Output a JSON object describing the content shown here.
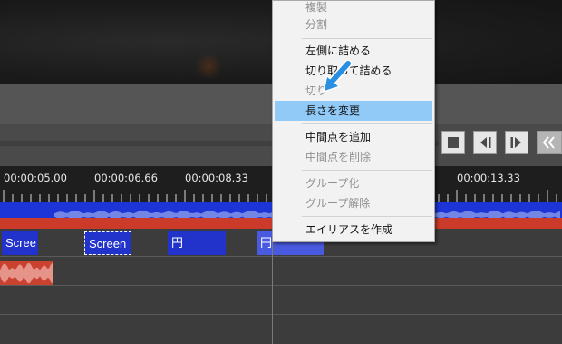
{
  "menu": {
    "items": [
      {
        "label": "複製",
        "enabled": false
      },
      {
        "label": "分割",
        "enabled": false
      },
      {
        "label": "左側に詰める",
        "enabled": true
      },
      {
        "label": "切り取って詰める",
        "enabled": true
      },
      {
        "label": "切り",
        "enabled": false
      },
      {
        "label": "長さを変更",
        "enabled": true,
        "highlighted": true
      },
      {
        "label": "中間点を追加",
        "enabled": true
      },
      {
        "label": "中間点を削除",
        "enabled": false
      },
      {
        "label": "グループ化",
        "enabled": false
      },
      {
        "label": "グループ解除",
        "enabled": false
      },
      {
        "label": "エイリアスを作成",
        "enabled": true
      }
    ],
    "highlight_color": "#91c9f7",
    "cursor_icon": "blue-arrow-cursor-icon"
  },
  "ruler": {
    "labels": [
      "00:00:05.00",
      "00:00:06.66",
      "00:00:08.33",
      "00:00:13.33"
    ]
  },
  "playback": {
    "buttons": [
      "stop-icon",
      "step-back-icon",
      "step-forward-icon",
      "rewind-icon"
    ]
  },
  "timeline": {
    "clips": [
      {
        "text": "Scree"
      },
      {
        "text": "Screen"
      },
      {
        "text": "円"
      },
      {
        "text": "円"
      }
    ],
    "colors": {
      "clip_blue": "#2233cc",
      "audio_blue": "#1d35d6",
      "audio_red": "#cc3a2a"
    }
  }
}
